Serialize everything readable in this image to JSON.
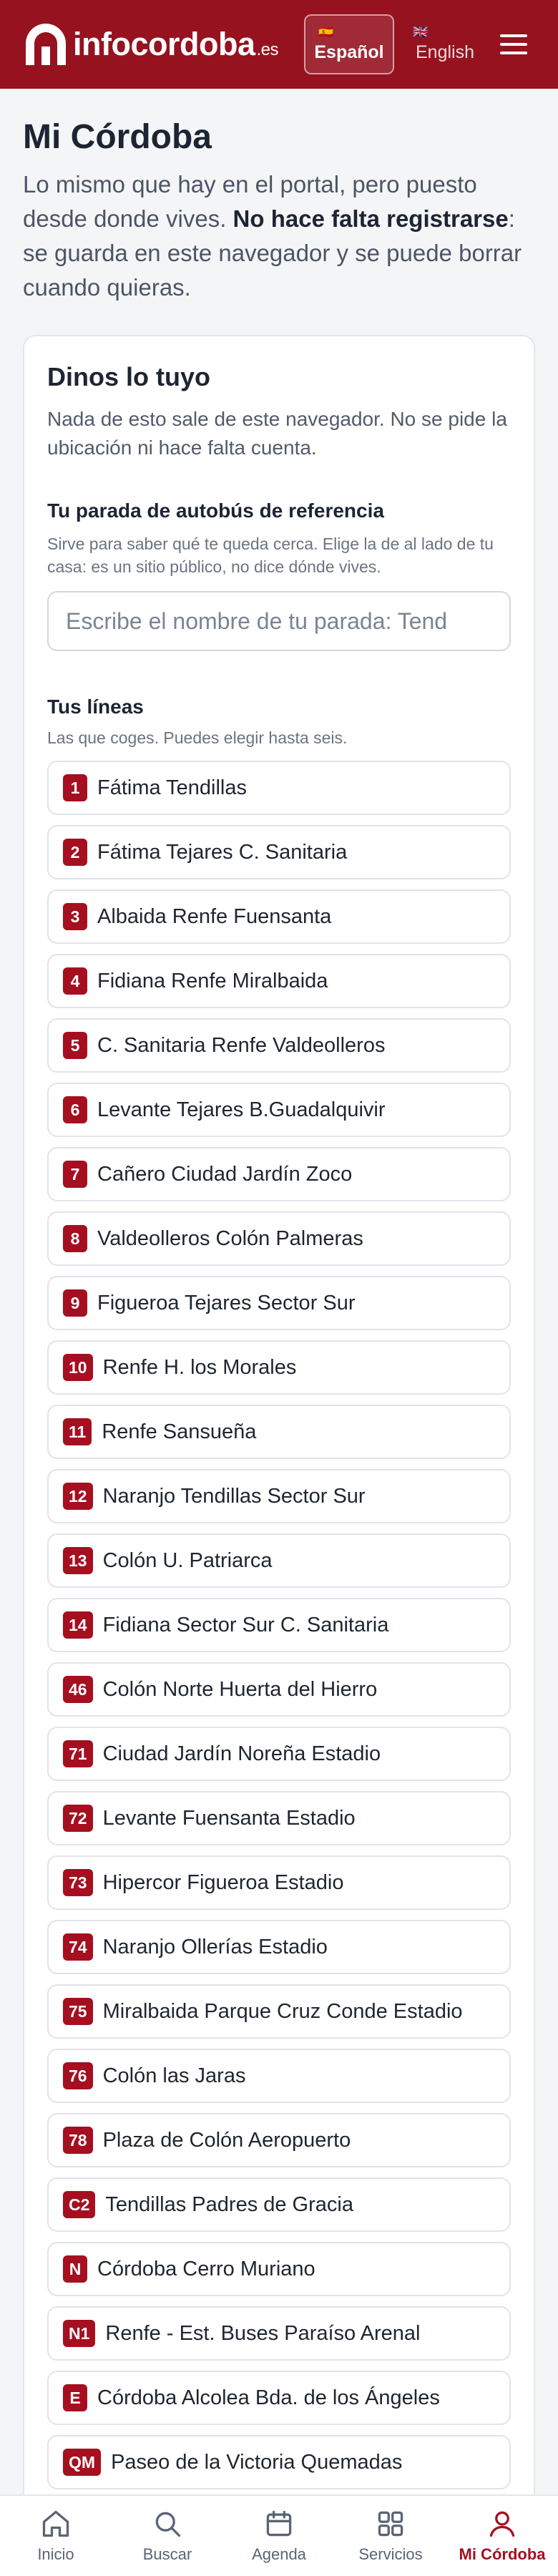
{
  "header": {
    "logo_text": "infocordoba",
    "logo_tld": ".es",
    "languages": [
      {
        "flag": "🇪🇸",
        "label": "Español",
        "active": true
      },
      {
        "flag": "🇬🇧",
        "label": "English",
        "active": false
      }
    ],
    "menu_icon": "hamburger-icon"
  },
  "page": {
    "title": "Mi Córdoba",
    "intro_text": "Lo mismo que hay en el portal, pero puesto desde donde vives. ",
    "intro_bold": "No hace falta registrarse",
    "intro_tail": ": se guarda en este navegador y se puede borrar cuando quieras."
  },
  "card": {
    "title": "Dinos lo tuyo",
    "subtitle": "Nada de esto sale de este navegador. No se pide la ubicación ni hace falta cuenta.",
    "stop": {
      "label": "Tu parada de autobús de referencia",
      "help": "Sirve para saber qué te queda cerca. Elige la de al lado de tu casa: es un sitio público, no dice dónde vives.",
      "placeholder": "Escribe el nombre de tu parada: Tend"
    },
    "lines": {
      "label": "Tus líneas",
      "help": "Las que coges. Puedes elegir hasta seis.",
      "items": [
        {
          "badge": "1",
          "name": "Fátima Tendillas"
        },
        {
          "badge": "2",
          "name": "Fátima Tejares C. Sanitaria"
        },
        {
          "badge": "3",
          "name": "Albaida Renfe Fuensanta"
        },
        {
          "badge": "4",
          "name": "Fidiana Renfe Miralbaida"
        },
        {
          "badge": "5",
          "name": "C. Sanitaria Renfe Valdeolleros"
        },
        {
          "badge": "6",
          "name": "Levante Tejares B.Guadalquivir"
        },
        {
          "badge": "7",
          "name": "Cañero Ciudad Jardín Zoco"
        },
        {
          "badge": "8",
          "name": "Valdeolleros Colón Palmeras"
        },
        {
          "badge": "9",
          "name": "Figueroa Tejares Sector Sur"
        },
        {
          "badge": "10",
          "name": "Renfe H. los Morales"
        },
        {
          "badge": "11",
          "name": "Renfe Sansueña"
        },
        {
          "badge": "12",
          "name": "Naranjo Tendillas Sector Sur"
        },
        {
          "badge": "13",
          "name": "Colón U. Patriarca"
        },
        {
          "badge": "14",
          "name": "Fidiana Sector Sur C. Sanitaria"
        },
        {
          "badge": "46",
          "name": "Colón Norte Huerta del Hierro"
        },
        {
          "badge": "71",
          "name": "Ciudad Jardín Noreña Estadio"
        },
        {
          "badge": "72",
          "name": "Levante Fuensanta Estadio"
        },
        {
          "badge": "73",
          "name": "Hipercor Figueroa Estadio"
        },
        {
          "badge": "74",
          "name": "Naranjo Ollerías Estadio"
        },
        {
          "badge": "75",
          "name": "Miralbaida Parque Cruz Conde Estadio"
        },
        {
          "badge": "76",
          "name": "Colón las Jaras"
        },
        {
          "badge": "78",
          "name": "Plaza de Colón Aeropuerto"
        },
        {
          "badge": "C2",
          "name": "Tendillas Padres de Gracia"
        },
        {
          "badge": "N",
          "name": "Córdoba Cerro Muriano"
        },
        {
          "badge": "N1",
          "name": "Renfe - Est. Buses Paraíso Arenal"
        },
        {
          "badge": "E",
          "name": "Córdoba Alcolea Bda. de los Ángeles"
        },
        {
          "badge": "QM",
          "name": "Paseo de la Victoria Quemadas"
        }
      ]
    }
  },
  "bottom_nav": [
    {
      "icon": "home-icon",
      "label": "Inicio",
      "active": false
    },
    {
      "icon": "search-icon",
      "label": "Buscar",
      "active": false
    },
    {
      "icon": "calendar-icon",
      "label": "Agenda",
      "active": false
    },
    {
      "icon": "grid-icon",
      "label": "Servicios",
      "active": false
    },
    {
      "icon": "user-icon",
      "label": "Mi Córdoba",
      "active": true
    }
  ],
  "colors": {
    "brand": "#96121f",
    "badge": "#a50f20"
  }
}
